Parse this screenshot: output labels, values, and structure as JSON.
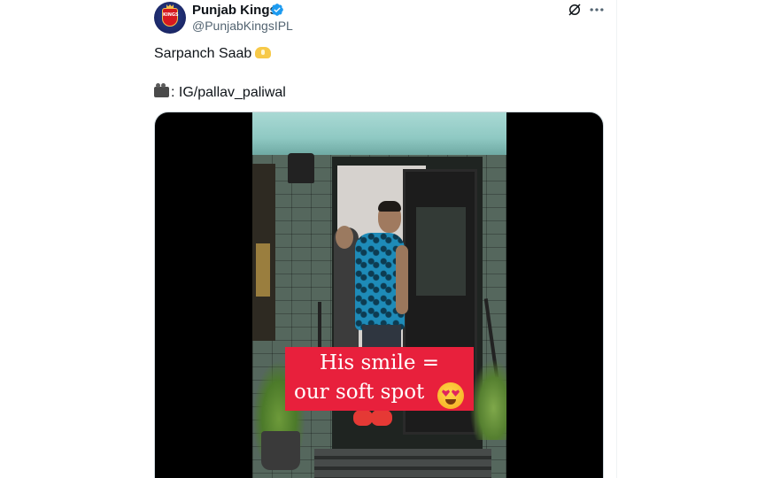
{
  "author": {
    "display_name": "Punjab Kings",
    "handle": "@PunjabKingsIPL",
    "avatar_text": "KINGS",
    "verified_icon": "verified-badge-icon"
  },
  "actions": {
    "grok_icon": "grok-icon",
    "more_icon": "more-icon"
  },
  "tweet": {
    "line1": "Sarpanch Saab",
    "line1_emoji": "heart-hands-emoji",
    "line2": ": IG/pallav_paliwal",
    "line2_emoji": "video-camera-emoji"
  },
  "media": {
    "caption_line1": "His smile =",
    "caption_line2": "our soft spot",
    "caption_emoji": "heart-eyes-emoji"
  },
  "colors": {
    "verified": "#1d9bf0",
    "caption_bg": "#e8203c",
    "text_primary": "#0f1419",
    "text_secondary": "#536471"
  }
}
